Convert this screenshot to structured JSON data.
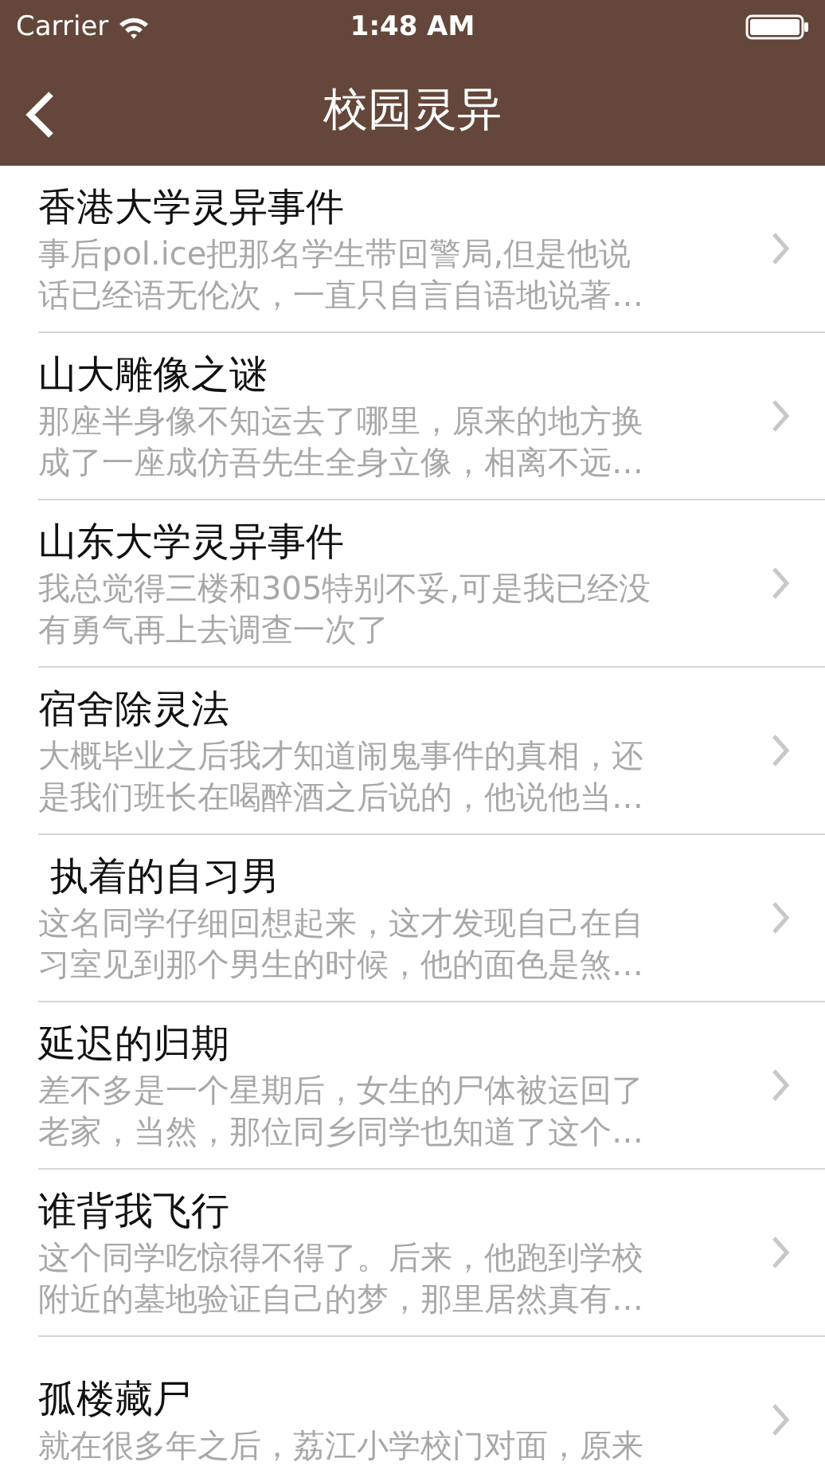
{
  "status_bar": {
    "carrier": "Carrier",
    "time": "1:48 AM"
  },
  "nav_bar": {
    "title": "校园灵异"
  },
  "items": [
    {
      "title": "香港大学灵异事件",
      "summary_lines": [
        "事后pol.ice把那名学生带回警局,但是他说",
        "话已经语无伦次，一直只自言自语地说著…"
      ]
    },
    {
      "title": "山大雕像之谜",
      "summary_lines": [
        "那座半身像不知运去了哪里，原来的地方换",
        "成了一座成仿吾先生全身立像，相离不远…"
      ]
    },
    {
      "title": "山东大学灵异事件",
      "summary_lines": [
        "我总觉得三楼和305特别不妥,可是我已经没",
        "有勇气再上去调查一次了"
      ]
    },
    {
      "title": "宿舍除灵法",
      "summary_lines": [
        "大概毕业之后我才知道闹鬼事件的真相，还",
        "是我们班长在喝醉酒之后说的，他说他当…"
      ]
    },
    {
      "title": " 执着的自习男",
      "summary_lines": [
        "这名同学仔细回想起来，这才发现自己在自",
        "习室见到那个男生的时候，他的面色是煞…"
      ]
    },
    {
      "title": "延迟的归期",
      "summary_lines": [
        "差不多是一个星期后，女生的尸体被运回了",
        "老家，当然，那位同乡同学也知道了这个…"
      ]
    },
    {
      "title": "谁背我飞行",
      "summary_lines": [
        "这个同学吃惊得不得了。后来，他跑到学校",
        "附近的墓地验证自己的梦，那里居然真有…"
      ]
    },
    {
      "title": "孤楼藏尸",
      "summary_lines": [
        "就在很多年之后，荔江小学校门对面，原来"
      ]
    }
  ]
}
